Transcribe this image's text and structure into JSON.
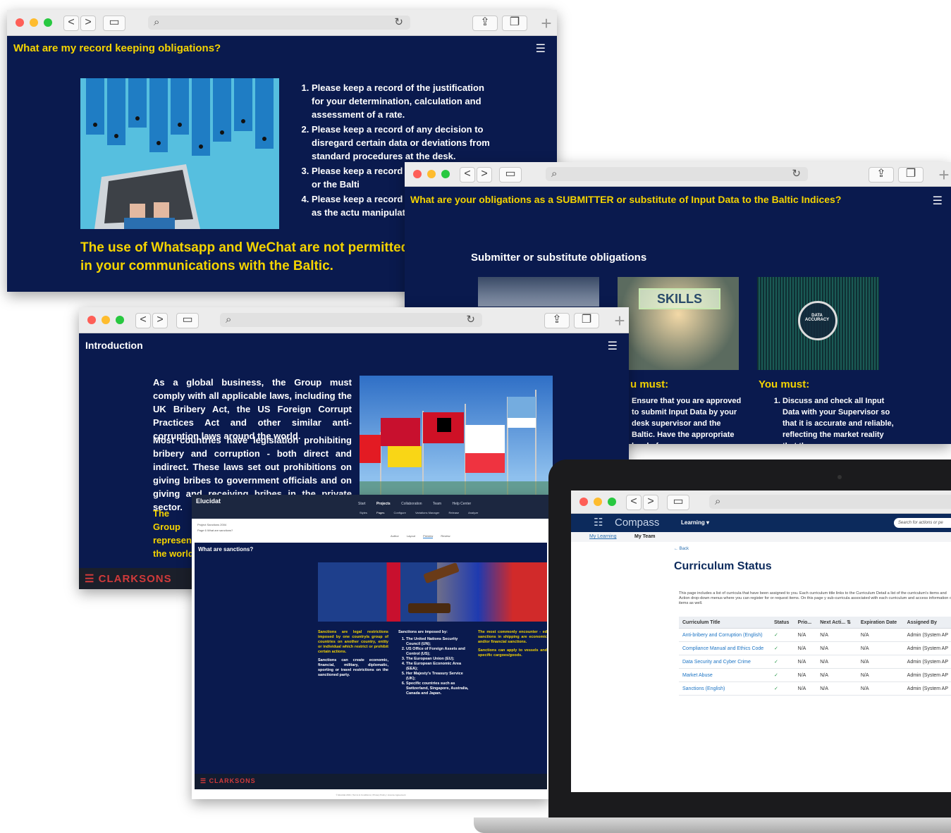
{
  "browser": {
    "back": "<",
    "forward": ">"
  },
  "win1": {
    "title": "What are my record keeping obligations?",
    "items": [
      "Please keep a record of the justification for your determination, calculation and assessment of a rate.",
      "Please keep a record of any decision to disregard certain data or deviations from standard procedures at the desk.",
      "Please keep a record of ar the supervisor or the Balti",
      "Please keep a record of ar or activity such as the actu manipulation of a benchm"
    ],
    "note": "The use of Whatsapp and WeChat are not permitted in your communications with the Baltic."
  },
  "win2": {
    "title": "What are your obligations as a SUBMITTER or substitute of Input Data to the Baltic Indices?",
    "subtitle": "Submitter or substitute obligations",
    "skills": "SKILLS",
    "data_accuracy": "DATA ACCURACY",
    "col2_heading": "u must:",
    "col2_text": "Ensure that you are approved to submit Input Data by your desk supervisor and the Baltic. Have the appropriate level of",
    "col3_heading": "You must:",
    "col3_items": [
      "Discuss and check all Input Data with your Supervisor so that it is accurate and reliable, reflecting the market reality that the"
    ]
  },
  "win3": {
    "title": "Introduction",
    "p1": "As a global business, the Group must comply with all applicable laws, including the UK Bribery Act, the US Foreign Corrupt Practices Act and other similar anti-corruption laws around the world.",
    "p2": "Most countries have legislation prohibiting bribery and corruption - both direct and indirect. These laws set out prohibitions on giving bribes to government officials and on giving and receiving bribes in the private sector.",
    "p3": "The Group represent the world",
    "logo": "CLARKSONS"
  },
  "win4": {
    "app": "Elucidat",
    "nav": [
      "Start",
      "Projects",
      "Collaboration",
      "Team",
      "Help Center"
    ],
    "subnav": [
      "Styles",
      "Pages",
      "Configure",
      "Variations Manager",
      "Release",
      "Analyze"
    ],
    "project_label": "Project",
    "project": "Sanctions 2004",
    "page_label": "Page 6",
    "page": "What are sanctions?",
    "modes": [
      "Author",
      "Layout",
      "Preview",
      "Review"
    ],
    "title": "What are sanctions?",
    "col1a": "Sanctions are legal restrictions imposed by one country/a group of countries on another country, entity or individual which restrict or prohibit certain actions.",
    "col1b": "Sanctions can create economic, financial, military, diplomatic, sporting or travel restrictions on the sanctioned party.",
    "col2_head": "Sanctions are imposed by:",
    "col2_items": [
      "The United Nations Security Council (UN);",
      "US Office of Foreign Assets and Control (US);",
      "The European Union (EU);",
      "The European Economic Area (EEA);",
      "Her Majesty's Treasury Service (UK);",
      "Specific countries such as Switzerland, Singapore, Australia, Canada and Japan."
    ],
    "col3a": "The most commonly encounter - ed sanctions in shipping are economic and/or financial sanctions.",
    "col3b": "Sanctions can apply to vessels and specific cargoes/goods.",
    "logo": "CLARKSONS",
    "footer": "© Elucidat 2021 | Terms & Conditions | Privacy Policy | Licence Agreement"
  },
  "win5": {
    "brand": "Compass",
    "menu": "Learning ▾",
    "search_placeholder": "Search for actions or pe",
    "tabs": [
      "My Learning",
      "My Team"
    ],
    "back": "← Back",
    "heading": "Curriculum Status",
    "desc": "This page includes a list of curricula that have been assigned to you. Each curriculum title links to the Curriculum Detail a list of the curriculum's items and Action drop-down menus where you can register for or request items. On this page y sub-curricula associated with each curriculum and access information on items as well.",
    "columns": [
      "Curriculum Title",
      "Status",
      "Prio...",
      "Next Acti... ⇅",
      "Expiration Date",
      "Assigned By"
    ],
    "rows": [
      {
        "title": "Anti-bribery and Corruption (English)",
        "status": "✓",
        "prio": "N/A",
        "next": "N/A",
        "exp": "N/A",
        "by": "Admin (System AP"
      },
      {
        "title": "Compliance Manual and Ethics Code",
        "status": "✓",
        "prio": "N/A",
        "next": "N/A",
        "exp": "N/A",
        "by": "Admin (System AP"
      },
      {
        "title": "Data Security and Cyber Crime",
        "status": "✓",
        "prio": "N/A",
        "next": "N/A",
        "exp": "N/A",
        "by": "Admin (System AP"
      },
      {
        "title": "Market Abuse",
        "status": "✓",
        "prio": "N/A",
        "next": "N/A",
        "exp": "N/A",
        "by": "Admin (System AP"
      },
      {
        "title": "Sanctions (English)",
        "status": "✓",
        "prio": "N/A",
        "next": "N/A",
        "exp": "N/A",
        "by": "Admin (System AP"
      }
    ]
  },
  "colors": {
    "navy": "#0a1a4e",
    "yellow": "#f5d400",
    "link": "#1c74c4"
  }
}
